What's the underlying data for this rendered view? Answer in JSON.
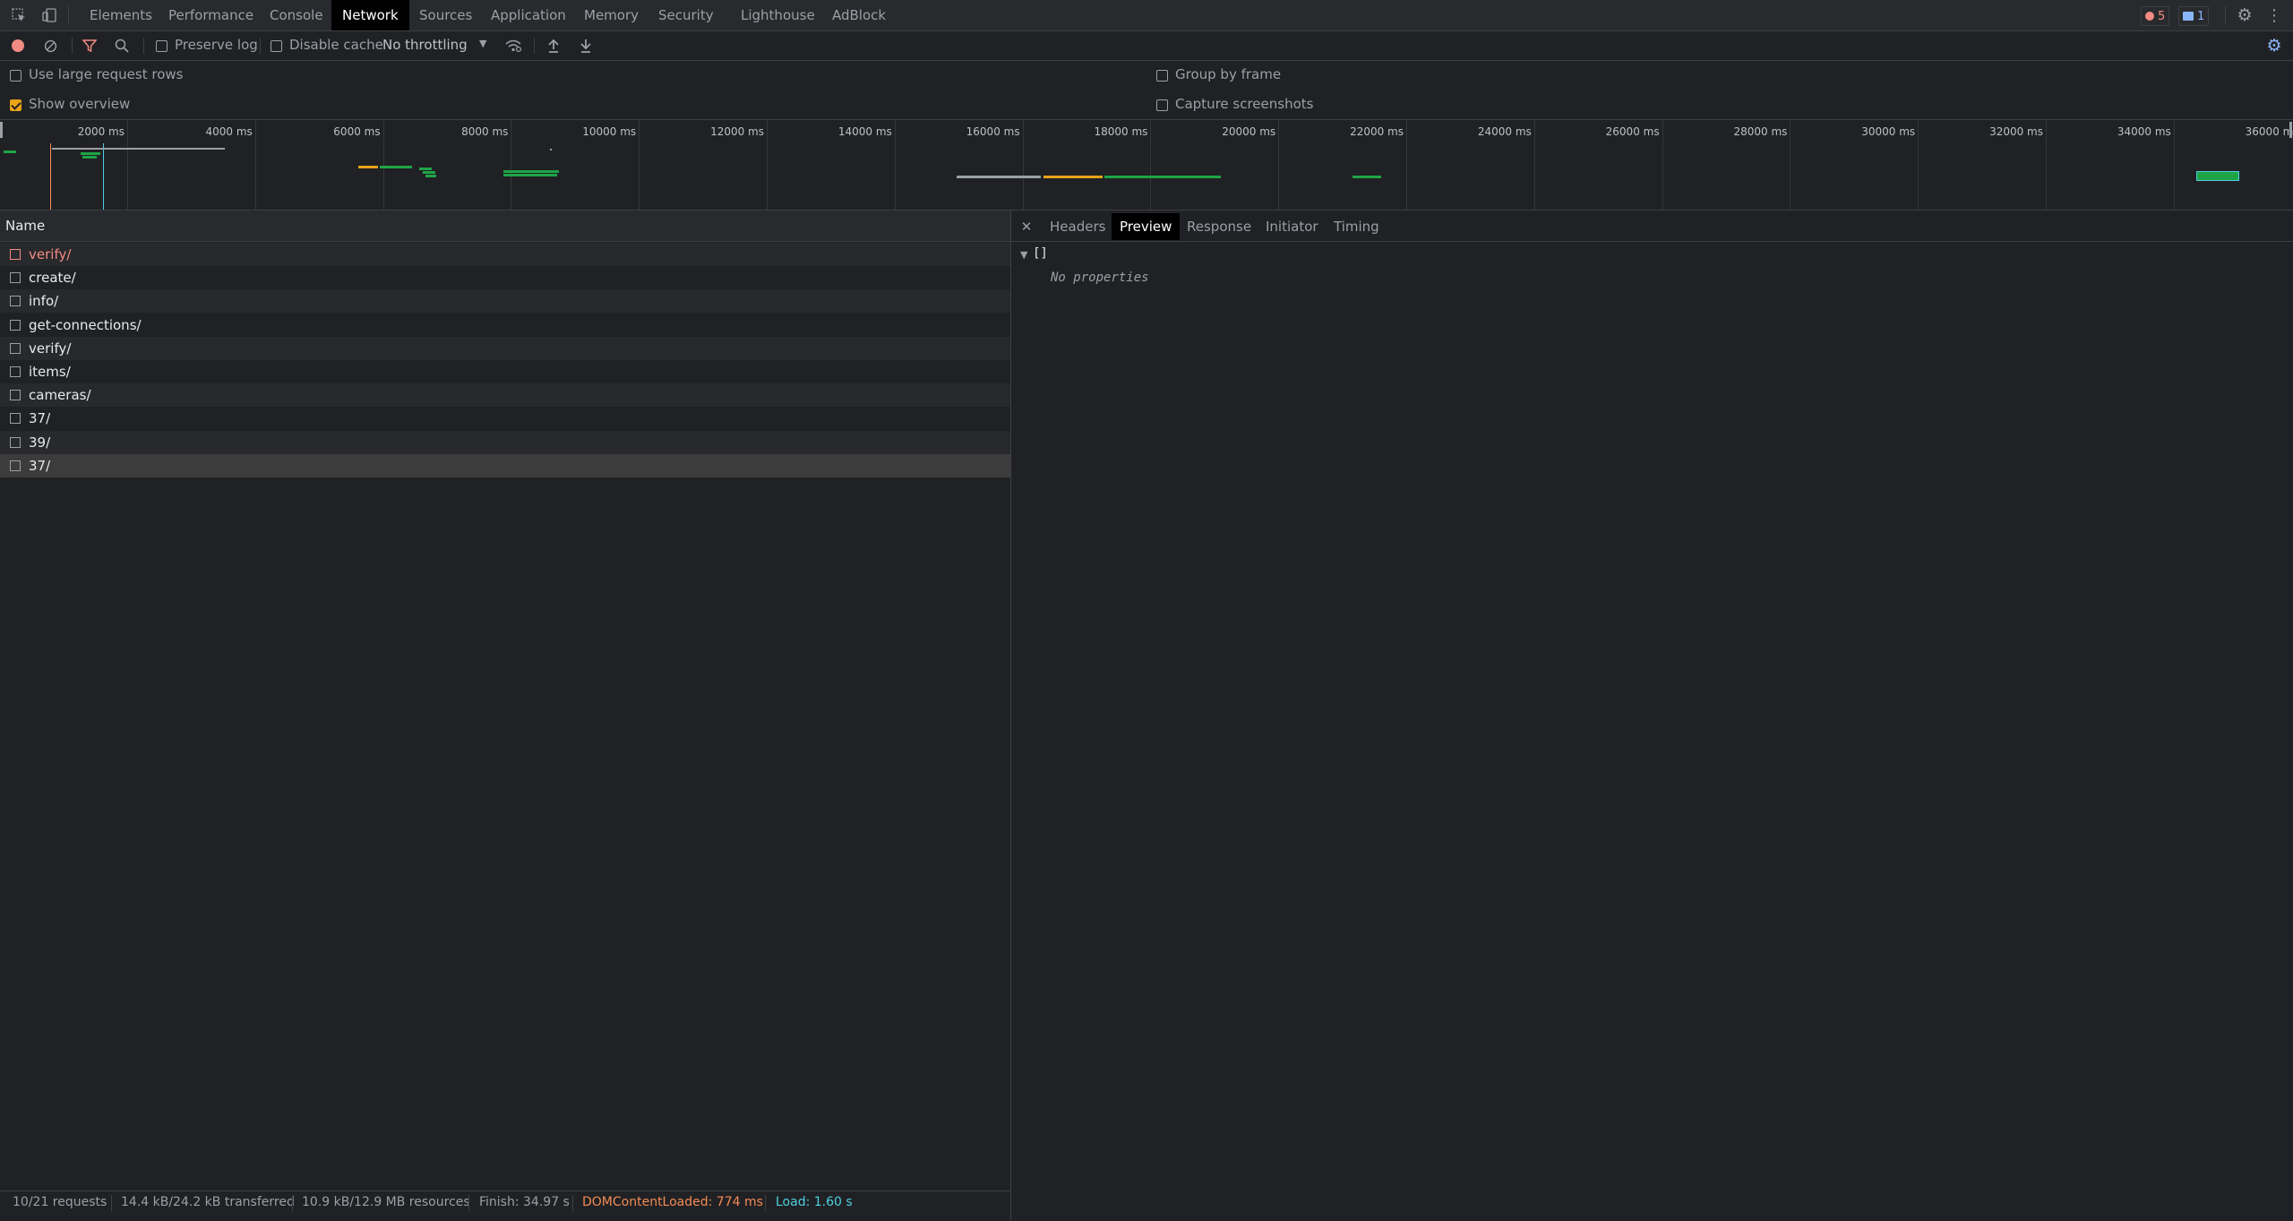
{
  "tabs": [
    "Elements",
    "Performance",
    "Console",
    "Network",
    "Sources",
    "Application",
    "Memory",
    "Security",
    "Lighthouse",
    "AdBlock"
  ],
  "badges": {
    "errors": "5",
    "messages": "1"
  },
  "toolbar": {
    "preserve_log": "Preserve log",
    "disable_cache": "Disable cache",
    "throttling": "No throttling"
  },
  "options": {
    "large_rows": "Use large request rows",
    "show_overview": "Show overview",
    "group_by_frame": "Group by frame",
    "capture_screenshots": "Capture screenshots"
  },
  "timeline": {
    "ticks": [
      "2000 ms",
      "4000 ms",
      "6000 ms",
      "8000 ms",
      "10000 ms",
      "12000 ms",
      "14000 ms",
      "16000 ms",
      "18000 ms",
      "20000 ms",
      "22000 ms",
      "24000 ms",
      "26000 ms",
      "28000 ms",
      "30000 ms",
      "32000 ms",
      "34000 ms",
      "36000 ms"
    ]
  },
  "table": {
    "header": "Name",
    "rows": [
      {
        "name": "verify/",
        "error": true
      },
      {
        "name": "create/",
        "error": false
      },
      {
        "name": "info/",
        "error": false
      },
      {
        "name": "get-connections/",
        "error": false
      },
      {
        "name": "verify/",
        "error": false
      },
      {
        "name": "items/",
        "error": false
      },
      {
        "name": "cameras/",
        "error": false
      },
      {
        "name": "37/",
        "error": false
      },
      {
        "name": "39/",
        "error": false
      },
      {
        "name": "37/",
        "error": false,
        "selected": true
      }
    ]
  },
  "detail": {
    "tabs": [
      "Headers",
      "Preview",
      "Response",
      "Initiator",
      "Timing"
    ],
    "preview_root": "[]",
    "preview_empty": "No properties"
  },
  "status": {
    "requests": "10/21 requests",
    "transferred": "14.4 kB/24.2 kB transferred",
    "resources": "10.9 kB/12.9 MB resources",
    "finish": "Finish: 34.97 s",
    "dcl": "DOMContentLoaded: 774 ms",
    "load": "Load: 1.60 s"
  },
  "colors": {
    "dcl": "#f28b54",
    "load": "#4dd0e1",
    "error": "#f28b82",
    "record": "#f28b82",
    "accent": "#8ab4f8"
  }
}
